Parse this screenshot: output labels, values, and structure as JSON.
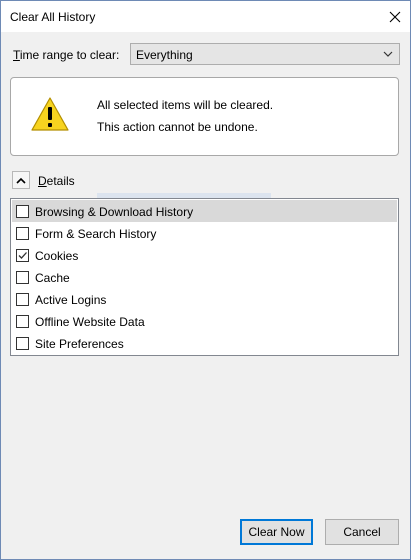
{
  "window": {
    "title": "Clear All History"
  },
  "time_range": {
    "label_accel": "T",
    "label_rest": "ime range to clear:",
    "selected": "Everything"
  },
  "warning": {
    "line1": "All selected items will be cleared.",
    "line2": "This action cannot be undone.",
    "icon": "warning-icon"
  },
  "details": {
    "label_accel": "D",
    "label_rest": "etails",
    "expanded": true
  },
  "items": [
    {
      "label": "Browsing & Download History",
      "checked": false
    },
    {
      "label": "Form & Search History",
      "checked": false
    },
    {
      "label": "Cookies",
      "checked": true
    },
    {
      "label": "Cache",
      "checked": false
    },
    {
      "label": "Active Logins",
      "checked": false
    },
    {
      "label": "Offline Website Data",
      "checked": false
    },
    {
      "label": "Site Preferences",
      "checked": false
    }
  ],
  "buttons": {
    "clear_now": "Clear Now",
    "cancel": "Cancel"
  },
  "colors": {
    "accent": "#0078d7",
    "warning_yellow": "#f7d31f"
  }
}
